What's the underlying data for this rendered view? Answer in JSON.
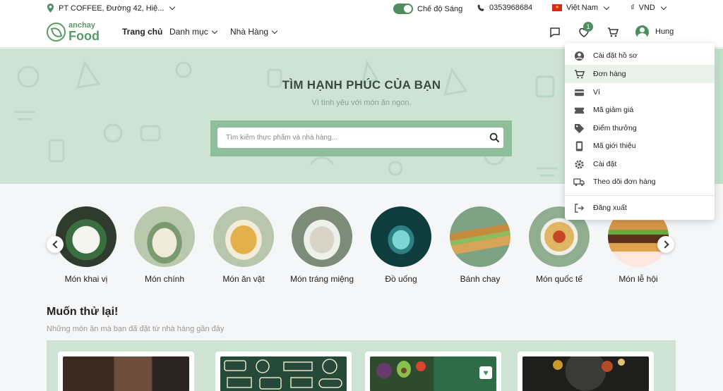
{
  "topbar": {
    "address": "PT COFFEE, Đường 42, Hiệ...",
    "theme_label": "Chế độ Sáng",
    "phone": "0353968684",
    "language": "Việt Nam",
    "currency_symbol": "₫",
    "currency": "VND"
  },
  "brand": {
    "top": "anchay",
    "bottom": "Food"
  },
  "nav": {
    "home": "Trang chủ",
    "categories": "Danh mục",
    "restaurants": "Nhà Hàng",
    "wishlist_count": "1",
    "username": "Hung"
  },
  "hero": {
    "title": "TÌM HẠNH PHÚC CỦA BẠN",
    "subtitle": "Vì tình yêu với món ăn ngon.",
    "search_placeholder": "Tìm kiếm thực phẩm và nhà hàng..."
  },
  "categories": [
    {
      "label": "Món khai vị"
    },
    {
      "label": "Món chính"
    },
    {
      "label": "Món ăn vặt"
    },
    {
      "label": "Món tráng miệng"
    },
    {
      "label": "Đồ uống"
    },
    {
      "label": "Bánh chay"
    },
    {
      "label": "Món quốc tế"
    },
    {
      "label": "Món lễ hội"
    }
  ],
  "section": {
    "title": "Muốn thử lại!",
    "subtitle": "Những món ăn mà bạn đã đặt từ nhà hàng gần đây"
  },
  "account_menu": {
    "items": [
      {
        "label": "Cài đặt hồ sơ",
        "icon": "user-circle-icon"
      },
      {
        "label": "Đơn hàng",
        "icon": "cart-icon"
      },
      {
        "label": "Ví",
        "icon": "wallet-icon"
      },
      {
        "label": "Mã giảm giá",
        "icon": "coupon-icon"
      },
      {
        "label": "Điểm thưởng",
        "icon": "tag-icon"
      },
      {
        "label": "Mã giới thiệu",
        "icon": "phone-share-icon"
      },
      {
        "label": "Cài đặt",
        "icon": "gear-icon"
      },
      {
        "label": "Theo dõi đơn hàng",
        "icon": "truck-icon"
      }
    ],
    "logout": "Đăng xuất"
  },
  "colors": {
    "brand_green": "#4e8e5e",
    "hero_bg": "#cfe3d4",
    "search_frame": "#8fbe9d"
  }
}
